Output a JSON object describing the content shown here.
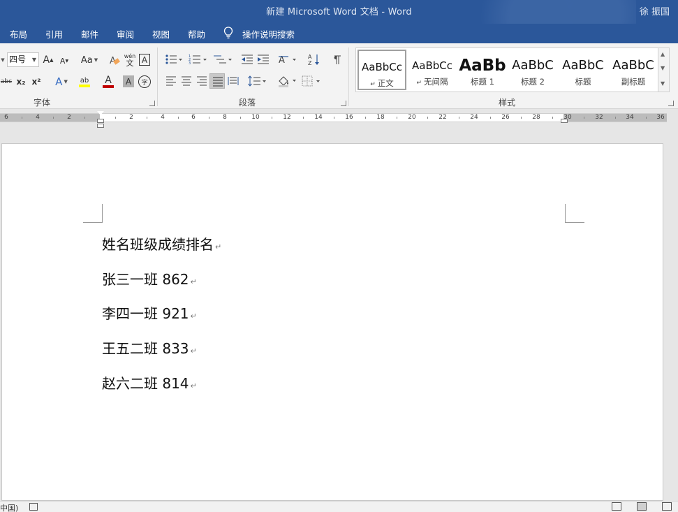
{
  "window": {
    "title": "新建 Microsoft Word 文档  -  Word",
    "user": "徐 振国"
  },
  "tabs": [
    "布局",
    "引用",
    "邮件",
    "审阅",
    "视图",
    "帮助"
  ],
  "tell_me": "操作说明搜索",
  "font_group": {
    "label": "字体",
    "size_value": "四号",
    "grow_label": "A",
    "shrink_label": "A",
    "case_label": "Aa",
    "pinyin_label": "wén",
    "pinyin_char": "文",
    "border_char": "A",
    "strike_label": "abc",
    "sub_label": "x₂",
    "sup_label": "x²",
    "effects_label": "A",
    "highlight_label": "ab",
    "color_label": "A",
    "shade_label": "A",
    "enclose_label": "字"
  },
  "paragraph_group": {
    "label": "段落"
  },
  "styles_group": {
    "label": "样式",
    "items": [
      {
        "sample": "AaBbCc",
        "name": "正文"
      },
      {
        "sample": "AaBbCc",
        "name": "无间隔"
      },
      {
        "sample": "AaBb",
        "name": "标题 1"
      },
      {
        "sample": "AaBbC",
        "name": "标题 2"
      },
      {
        "sample": "AaBbC",
        "name": "标题"
      },
      {
        "sample": "AaBbC",
        "name": "副标题"
      }
    ]
  },
  "ruler": {
    "left_numbers": [
      "6",
      "4",
      "2"
    ],
    "right_numbers": [
      "2",
      "4",
      "6",
      "8",
      "10",
      "12",
      "14",
      "16",
      "18",
      "20",
      "22",
      "24",
      "26",
      "28",
      "30",
      "32",
      "34",
      "36"
    ]
  },
  "document": {
    "lines": [
      "姓名班级成绩排名",
      "张三一班 862",
      "李四一班 921",
      "王五二班 833",
      "赵六二班 814"
    ],
    "paragraph_mark": "↵"
  },
  "status": {
    "language": "中国)"
  }
}
